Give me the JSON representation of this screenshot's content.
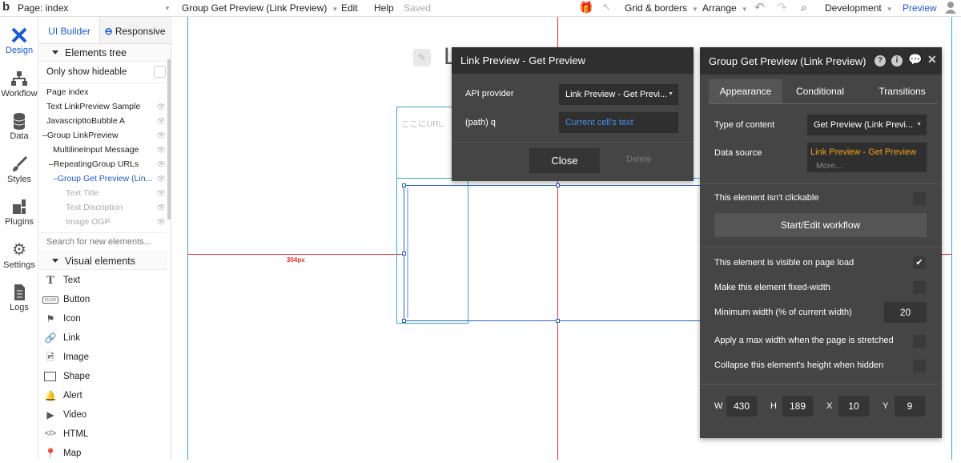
{
  "topbar": {
    "page": "Page: index",
    "element": "Group Get Preview (Link Preview)",
    "edit": "Edit",
    "help": "Help",
    "saved": "Saved",
    "grid": "Grid & borders",
    "arrange": "Arrange",
    "env": "Development",
    "preview": "Preview"
  },
  "nav": [
    {
      "label": "Design"
    },
    {
      "label": "Workflow"
    },
    {
      "label": "Data"
    },
    {
      "label": "Styles"
    },
    {
      "label": "Plugins"
    },
    {
      "label": "Settings"
    },
    {
      "label": "Logs"
    }
  ],
  "panel": {
    "tab_ui": "UI Builder",
    "tab_resp": "Responsive",
    "tree_header": "Elements tree",
    "only_hideable": "Only show hideable",
    "tree": [
      "Page index",
      "Text LinkPreview Sample",
      "JavascripttoBubble A",
      "Group LinkPreview",
      "MultilineInput Message",
      "RepeatingGroup URLs",
      "Group Get Preview (Lin...",
      "Text Title",
      "Text Discription",
      "Image OGP"
    ],
    "search_placeholder": "Search for new elements...",
    "visual_header": "Visual elements",
    "visual": [
      "Text",
      "Button",
      "Icon",
      "Link",
      "Image",
      "Shape",
      "Alert",
      "Video",
      "HTML",
      "Map"
    ]
  },
  "canvas": {
    "heading_char": "L",
    "input_text": "ここにURL:",
    "ruler_label": "304px",
    "ruler_color": "#e03030",
    "guide_color": "#38a8c8"
  },
  "modalA": {
    "title": "Link Preview - Get Preview",
    "label_provider": "API provider",
    "provider_value": "Link Preview - Get Previ...",
    "label_q": "(path) q",
    "q_value": "Current cell's text",
    "close": "Close",
    "delete": "Delete"
  },
  "modalB": {
    "title": "Group Get Preview (Link Preview)",
    "tabs": [
      "Appearance",
      "Conditional",
      "Transitions"
    ],
    "type_label": "Type of content",
    "type_value": "Get Preview (Link Previ...",
    "ds_label": "Data source",
    "ds_value": "Link Preview - Get Preview",
    "ds_more": "More...",
    "not_clickable": "This element isn't clickable",
    "workflow_btn": "Start/Edit workflow",
    "visible_on_load": "This element is visible on page load",
    "fixed_width": "Make this element fixed-width",
    "min_width": "Minimum width (% of current width)",
    "min_width_val": "20",
    "max_width": "Apply a max width when the page is stretched",
    "collapse": "Collapse this element's height when hidden",
    "w_label": "W",
    "w": "430",
    "h_label": "H",
    "h": "189",
    "x_label": "X",
    "x": "10",
    "y_label": "Y",
    "y": "9"
  },
  "colors": {
    "accent": "#1a5ad4",
    "orange": "#f0a020",
    "dark": "#454545"
  }
}
